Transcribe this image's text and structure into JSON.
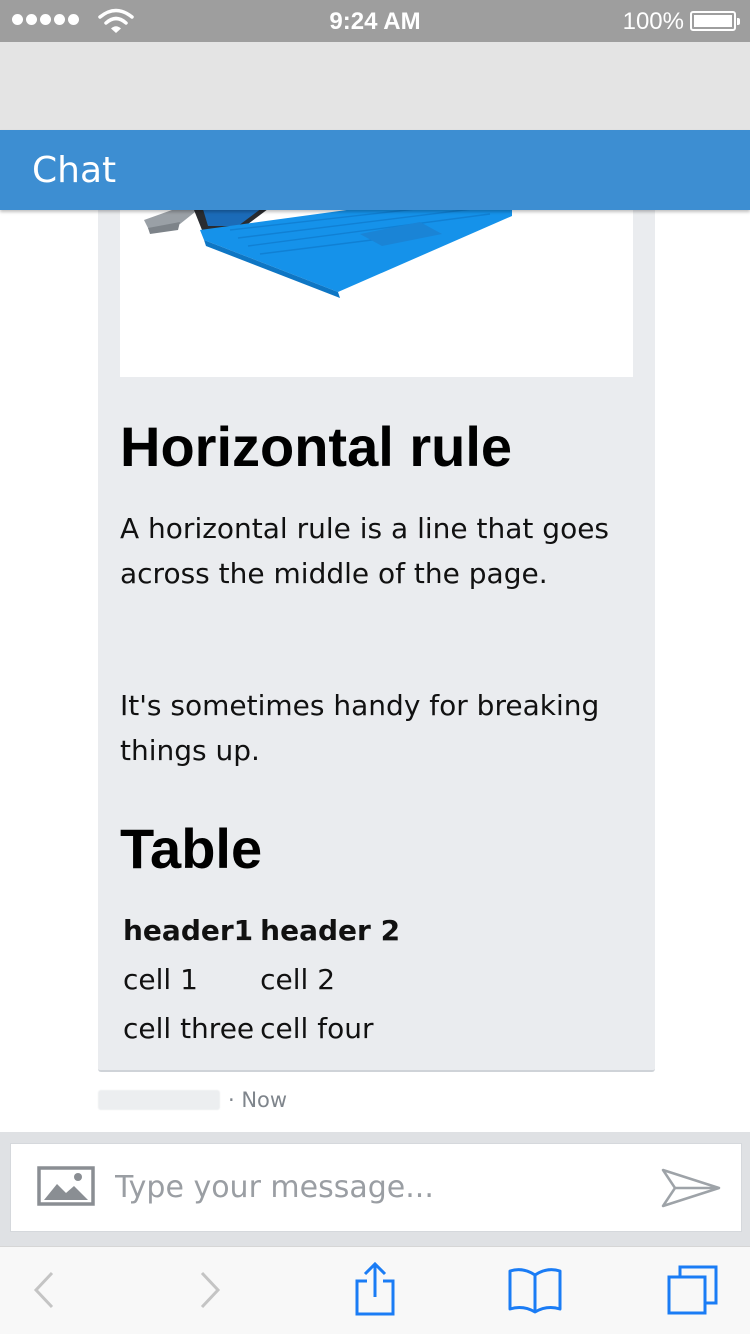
{
  "status_bar": {
    "time": "9:24 AM",
    "battery_percent": "100%",
    "battery_level": 1.0,
    "signal_bars": 5,
    "icons": [
      "signal-dots-icon",
      "wifi-icon",
      "battery-icon"
    ]
  },
  "header": {
    "title": "Chat",
    "background_color": "#3d8ed2"
  },
  "message": {
    "image_icon": "laptop-image",
    "heading_1": "Horizontal rule",
    "paragraph_1": "A horizontal rule is a line that goes across the middle of the page.",
    "paragraph_2": "It's sometimes handy for breaking things up.",
    "heading_2": "Table",
    "table": {
      "headers": [
        "header1",
        "header 2"
      ],
      "rows": [
        [
          "cell 1",
          "cell 2"
        ],
        [
          "cell three",
          "cell four"
        ]
      ]
    },
    "timestamp": "· Now"
  },
  "composer": {
    "placeholder": "Type your message...",
    "value": "",
    "upload_icon": "image-upload-icon",
    "send_icon": "send-icon"
  },
  "browser_toolbar": {
    "icons": [
      "back-icon",
      "forward-icon",
      "share-icon",
      "bookmarks-icon",
      "tabs-icon"
    ],
    "accent_color": "#1a7cf5"
  }
}
